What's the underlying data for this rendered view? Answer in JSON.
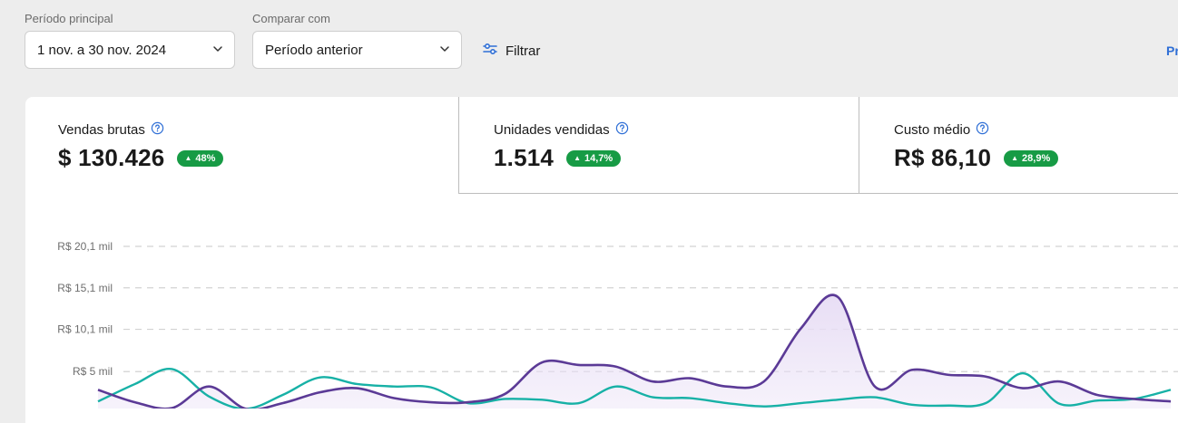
{
  "filters": {
    "primary_period": {
      "label": "Período principal",
      "value": "1 nov. a 30 nov. 2024",
      "icon": "chevron-down-icon"
    },
    "compare_with": {
      "label": "Comparar com",
      "value": "Período anterior",
      "icon": "chevron-down-icon"
    },
    "filter_button": {
      "label": "Filtrar",
      "icon": "sliders-icon"
    },
    "right_link_partial": "Pr"
  },
  "metrics": [
    {
      "title": "Vendas brutas",
      "value": "$ 130.426",
      "change": "48%",
      "icon": "help-icon",
      "selected": true
    },
    {
      "title": "Unidades vendidas",
      "value": "1.514",
      "change": "14,7%",
      "icon": "help-icon",
      "selected": false
    },
    {
      "title": "Custo médio",
      "value": "R$ 86,10",
      "change": "28,9%",
      "icon": "help-icon",
      "selected": false
    }
  ],
  "colors": {
    "accent_positive": "#179b45",
    "series_current": "#5b3a96",
    "series_previous": "#17b1a6",
    "area_fill": "#e8def5",
    "link": "#2f6fd6"
  },
  "chart_data": {
    "type": "area",
    "y_tick_labels": [
      "R$ 20,1 mil",
      "R$ 15,1 mil",
      "R$ 10,1 mil",
      "R$ 5 mil"
    ],
    "y_ticks": [
      20.1,
      15.1,
      10.1,
      5
    ],
    "ylim": [
      0,
      23
    ],
    "grid": true,
    "x": [
      1,
      2,
      3,
      4,
      5,
      6,
      7,
      8,
      9,
      10,
      11,
      12,
      13,
      14,
      15,
      16,
      17,
      18,
      19,
      20,
      21,
      22,
      23,
      24,
      25,
      26,
      27,
      28,
      29,
      30
    ],
    "series": [
      {
        "values": [
          2.8,
          1.3,
          0.6,
          3.2,
          0.5,
          1.2,
          2.5,
          3.0,
          1.8,
          1.3,
          1.3,
          2.3,
          6.1,
          5.8,
          5.6,
          3.8,
          4.2,
          3.2,
          3.8,
          10.2,
          14.0,
          3.2,
          5.2,
          4.6,
          4.4,
          3.0,
          3.8,
          2.2,
          1.7,
          1.4
        ]
      },
      {
        "values": [
          1.4,
          3.5,
          5.3,
          2.0,
          0.5,
          2.2,
          4.3,
          3.5,
          3.2,
          3.1,
          1.2,
          1.7,
          1.6,
          1.2,
          3.2,
          1.9,
          1.8,
          1.2,
          0.8,
          1.2,
          1.6,
          1.9,
          1.0,
          0.9,
          1.2,
          4.8,
          1.1,
          1.5,
          1.7,
          2.8
        ]
      }
    ]
  }
}
